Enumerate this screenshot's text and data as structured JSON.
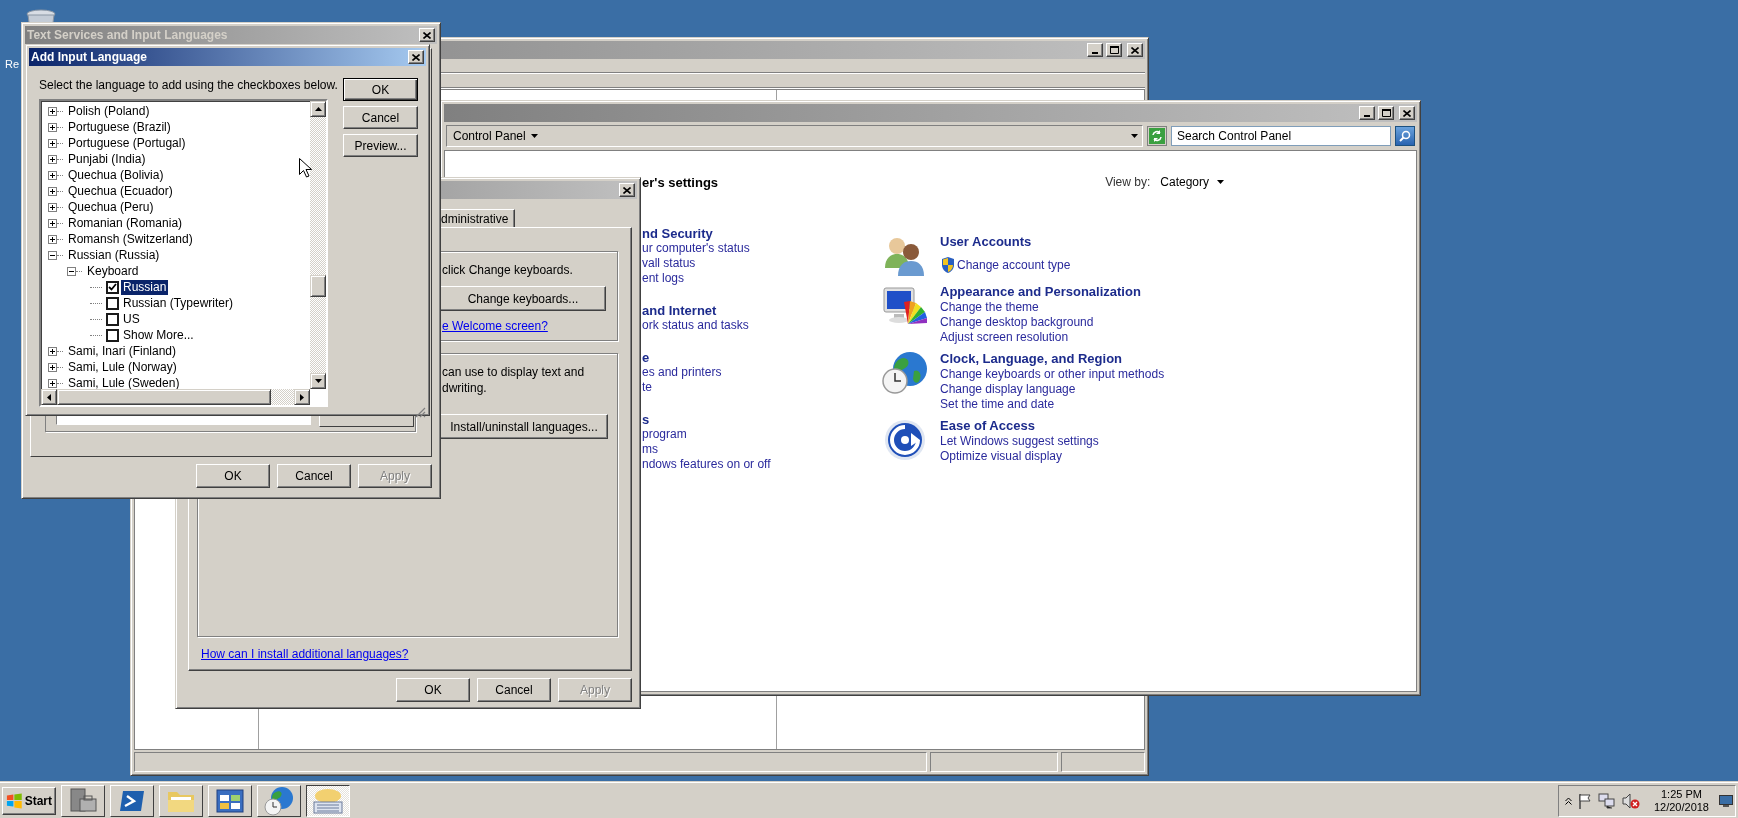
{
  "desktop": {
    "icon_label": "Re"
  },
  "explorer_window": {
    "active": false
  },
  "control_panel": {
    "active": false,
    "address": "Control Panel",
    "search": {
      "placeholder": "Search Control Panel"
    },
    "heading": "er's settings",
    "view_by": {
      "label": "View by:",
      "value": "Category"
    },
    "left_categories": [
      {
        "title": "nd Security",
        "links": [
          "ur computer's status",
          "vall status",
          "ent logs"
        ]
      },
      {
        "title": "and Internet",
        "links": [
          "ork status and tasks"
        ]
      },
      {
        "title": "e",
        "links": [
          "es and printers",
          "te"
        ]
      },
      {
        "title": "s",
        "links": [
          "program",
          "ms",
          "ndows features on or off"
        ]
      }
    ],
    "right_categories": [
      {
        "kind": "users",
        "title": "User Accounts",
        "links": [
          {
            "text": "Change account type",
            "shield": true
          }
        ]
      },
      {
        "kind": "appearance",
        "title": "Appearance and Personalization",
        "links": [
          {
            "text": "Change the theme",
            "shield": false
          },
          {
            "text": "Change desktop background",
            "shield": false
          },
          {
            "text": "Adjust screen resolution",
            "shield": false
          }
        ]
      },
      {
        "kind": "clock",
        "title": "Clock, Language, and Region",
        "links": [
          {
            "text": "Change keyboards or other input methods",
            "shield": false
          },
          {
            "text": "Change display language",
            "shield": false
          },
          {
            "text": "Set the time and date",
            "shield": false
          }
        ]
      },
      {
        "kind": "ease",
        "title": "Ease of Access",
        "links": [
          {
            "text": "Let Windows suggest settings",
            "shield": false
          },
          {
            "text": "Optimize visual display",
            "shield": false
          }
        ]
      }
    ]
  },
  "region_dialog": {
    "active": false,
    "tabs": [
      {
        "label": "dministrative",
        "selected": false
      }
    ],
    "keyboards_group": {
      "text": "click Change keyboards.",
      "button": "Change keyboards...",
      "link": "e Welcome screen?"
    },
    "languages_group": {
      "lines": [
        "can use to display text and",
        "dwriting."
      ],
      "button": "Install/uninstall languages..."
    },
    "help_link": "How can I install additional languages?",
    "buttons": [
      {
        "label": "OK",
        "disabled": false
      },
      {
        "label": "Cancel",
        "disabled": false
      },
      {
        "label": "Apply",
        "disabled": true
      }
    ]
  },
  "text_services_dialog": {
    "title": "Text Services and Input Languages",
    "active": false,
    "buttons": [
      {
        "label": "OK",
        "disabled": false
      },
      {
        "label": "Cancel",
        "disabled": false
      },
      {
        "label": "Apply",
        "disabled": true
      }
    ]
  },
  "add_language_dialog": {
    "title": "Add Input Language",
    "active": true,
    "prompt": "Select the language to add using the checkboxes below.",
    "buttons": [
      {
        "label": "OK",
        "default": true
      },
      {
        "label": "Cancel",
        "default": false
      },
      {
        "label": "Preview...",
        "default": false
      }
    ],
    "tree": [
      {
        "kind": "language",
        "label": "Polish (Poland)",
        "expanded": false,
        "selected": false
      },
      {
        "kind": "language",
        "label": "Portuguese (Brazil)",
        "expanded": false,
        "selected": false
      },
      {
        "kind": "language",
        "label": "Portuguese (Portugal)",
        "expanded": false,
        "selected": false
      },
      {
        "kind": "language",
        "label": "Punjabi (India)",
        "expanded": false,
        "selected": false
      },
      {
        "kind": "language",
        "label": "Quechua (Bolivia)",
        "expanded": false,
        "selected": false
      },
      {
        "kind": "language",
        "label": "Quechua (Ecuador)",
        "expanded": false,
        "selected": false
      },
      {
        "kind": "language",
        "label": "Quechua (Peru)",
        "expanded": false,
        "selected": false
      },
      {
        "kind": "language",
        "label": "Romanian (Romania)",
        "expanded": false,
        "selected": false
      },
      {
        "kind": "language",
        "label": "Romansh (Switzerland)",
        "expanded": false,
        "selected": false
      },
      {
        "kind": "language",
        "label": "Russian (Russia)",
        "expanded": true,
        "selected": false,
        "children": [
          {
            "kind": "group",
            "label": "Keyboard",
            "expanded": true,
            "selected": false,
            "children": [
              {
                "kind": "checkbox",
                "label": "Russian",
                "checked": true,
                "selected": true
              },
              {
                "kind": "checkbox",
                "label": "Russian (Typewriter)",
                "checked": false,
                "selected": false
              },
              {
                "kind": "checkbox",
                "label": "US",
                "checked": false,
                "selected": false
              },
              {
                "kind": "checkbox",
                "label": "Show More...",
                "checked": false,
                "selected": false
              }
            ]
          }
        ]
      },
      {
        "kind": "language",
        "label": "Sami, Inari (Finland)",
        "expanded": false,
        "selected": false
      },
      {
        "kind": "language",
        "label": "Sami, Lule (Norway)",
        "expanded": false,
        "selected": false
      },
      {
        "kind": "language",
        "label": "Sami, Lule (Sweden)",
        "expanded": false,
        "selected": false
      }
    ]
  },
  "taskbar": {
    "start": "Start",
    "buttons": [
      {
        "kind": "server",
        "selected": false
      },
      {
        "kind": "terminal",
        "selected": false
      },
      {
        "kind": "folder",
        "selected": false
      },
      {
        "kind": "panel",
        "selected": false
      },
      {
        "kind": "globe",
        "selected": false
      },
      {
        "kind": "keyboard",
        "selected": true
      }
    ],
    "time": "1:25 PM",
    "date": "12/20/2018"
  }
}
